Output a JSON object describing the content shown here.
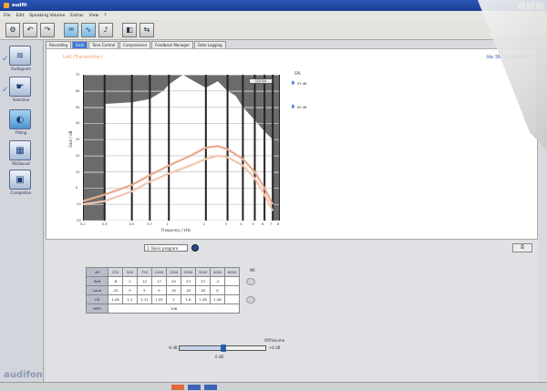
{
  "window": {
    "title": "audfit"
  },
  "menu": [
    "File",
    "Edit",
    "Speaking Volume",
    "Extras",
    "View",
    "?"
  ],
  "toolbar": {
    "buttons": [
      "open-icon",
      "undo-icon",
      "redo-icon",
      "fit-icon",
      "wave-icon",
      "audio-icon",
      "speaker-icon",
      "back-icon"
    ]
  },
  "sidebar": {
    "items": [
      {
        "label": "Audiogram",
        "icon": "audiogram-icon"
      },
      {
        "label": "Selection",
        "icon": "selection-icon"
      },
      {
        "label": "Fitting",
        "icon": "fitting-icon"
      },
      {
        "label": "MicSound",
        "icon": "mic-icon"
      },
      {
        "label": "Completion",
        "icon": "complete-icon"
      }
    ],
    "brand": "audifon",
    "brand_sub": "hearing systems"
  },
  "tabs": [
    "Recording",
    "Gain",
    "Tone Control",
    "Compression",
    "Feedback Manager",
    "Data Logging"
  ],
  "upper": {
    "side_title": "Left (Transmitter)",
    "side_right": "Ida 38 (Transmitter)",
    "spl_label": "SPL",
    "legend": [
      "55 dB",
      "80 dB"
    ],
    "zoom_label": "1|2|3|4"
  },
  "chart_data": {
    "type": "line",
    "ylabel": "Gain / dB",
    "xlabel": "Frequency / kHz",
    "x_ticks": [
      "0.2",
      "0.3",
      "0.5",
      "0.7",
      "1",
      "2",
      "3",
      "4",
      "5",
      "6",
      "7",
      "8"
    ],
    "y_ticks": [
      "70",
      "60",
      "50",
      "40",
      "30",
      "20",
      "10",
      "0",
      "-10",
      "-20"
    ],
    "ylim": [
      -20,
      70
    ],
    "xlim": [
      0.2,
      8
    ],
    "grid": true,
    "series": [
      {
        "name": "55 dB",
        "x": [
          0.2,
          0.3,
          0.5,
          0.7,
          1,
          1.5,
          2,
          2.5,
          3,
          4,
          5,
          6,
          7
        ],
        "y": [
          -8,
          -4,
          2,
          8,
          14,
          20,
          25,
          26,
          24,
          18,
          10,
          0,
          -10
        ]
      },
      {
        "name": "80 dB",
        "x": [
          0.2,
          0.3,
          0.5,
          0.7,
          1,
          1.5,
          2,
          2.5,
          3,
          4,
          5,
          6,
          7
        ],
        "y": [
          -10,
          -8,
          -2,
          4,
          9,
          14,
          18,
          20,
          19,
          14,
          6,
          -4,
          -14
        ]
      }
    ],
    "upper_envelope": {
      "x": [
        0.3,
        0.5,
        0.7,
        0.9,
        1,
        1.3,
        1.6,
        2,
        2.5,
        3,
        3.5,
        4,
        5,
        6,
        7
      ],
      "y": [
        52,
        53,
        55,
        60,
        64,
        70,
        66,
        62,
        66,
        60,
        57,
        50,
        42,
        35,
        30
      ]
    }
  },
  "program": {
    "value": "1: Basic program"
  },
  "freq_table": {
    "headers": [
      "dB",
      "250",
      "500",
      "750",
      "1000",
      "1500",
      "2000",
      "3000",
      "4000",
      "6000"
    ],
    "rows": [
      {
        "label": "Soft",
        "values": [
          "-8",
          "2",
          "12",
          "17",
          "20",
          "23",
          "23",
          "-2",
          ""
        ]
      },
      {
        "label": "Loud",
        "values": [
          "-10",
          "0",
          "5",
          "9",
          "10",
          "18",
          "18",
          "0",
          ""
        ]
      },
      {
        "label": "CR",
        "values": [
          "1.28",
          "1.1",
          "2.11",
          "1.25",
          "2",
          "1.8",
          "1.28",
          "1.28",
          ""
        ]
      }
    ],
    "mpo_label": "MPO",
    "mpo_value": "108",
    "nr_label": "NR"
  },
  "mic": {
    "title": "Off/Volume",
    "min": "-6 dB",
    "max": "+6 dB",
    "value": "0 dB",
    "level": 0.5
  }
}
